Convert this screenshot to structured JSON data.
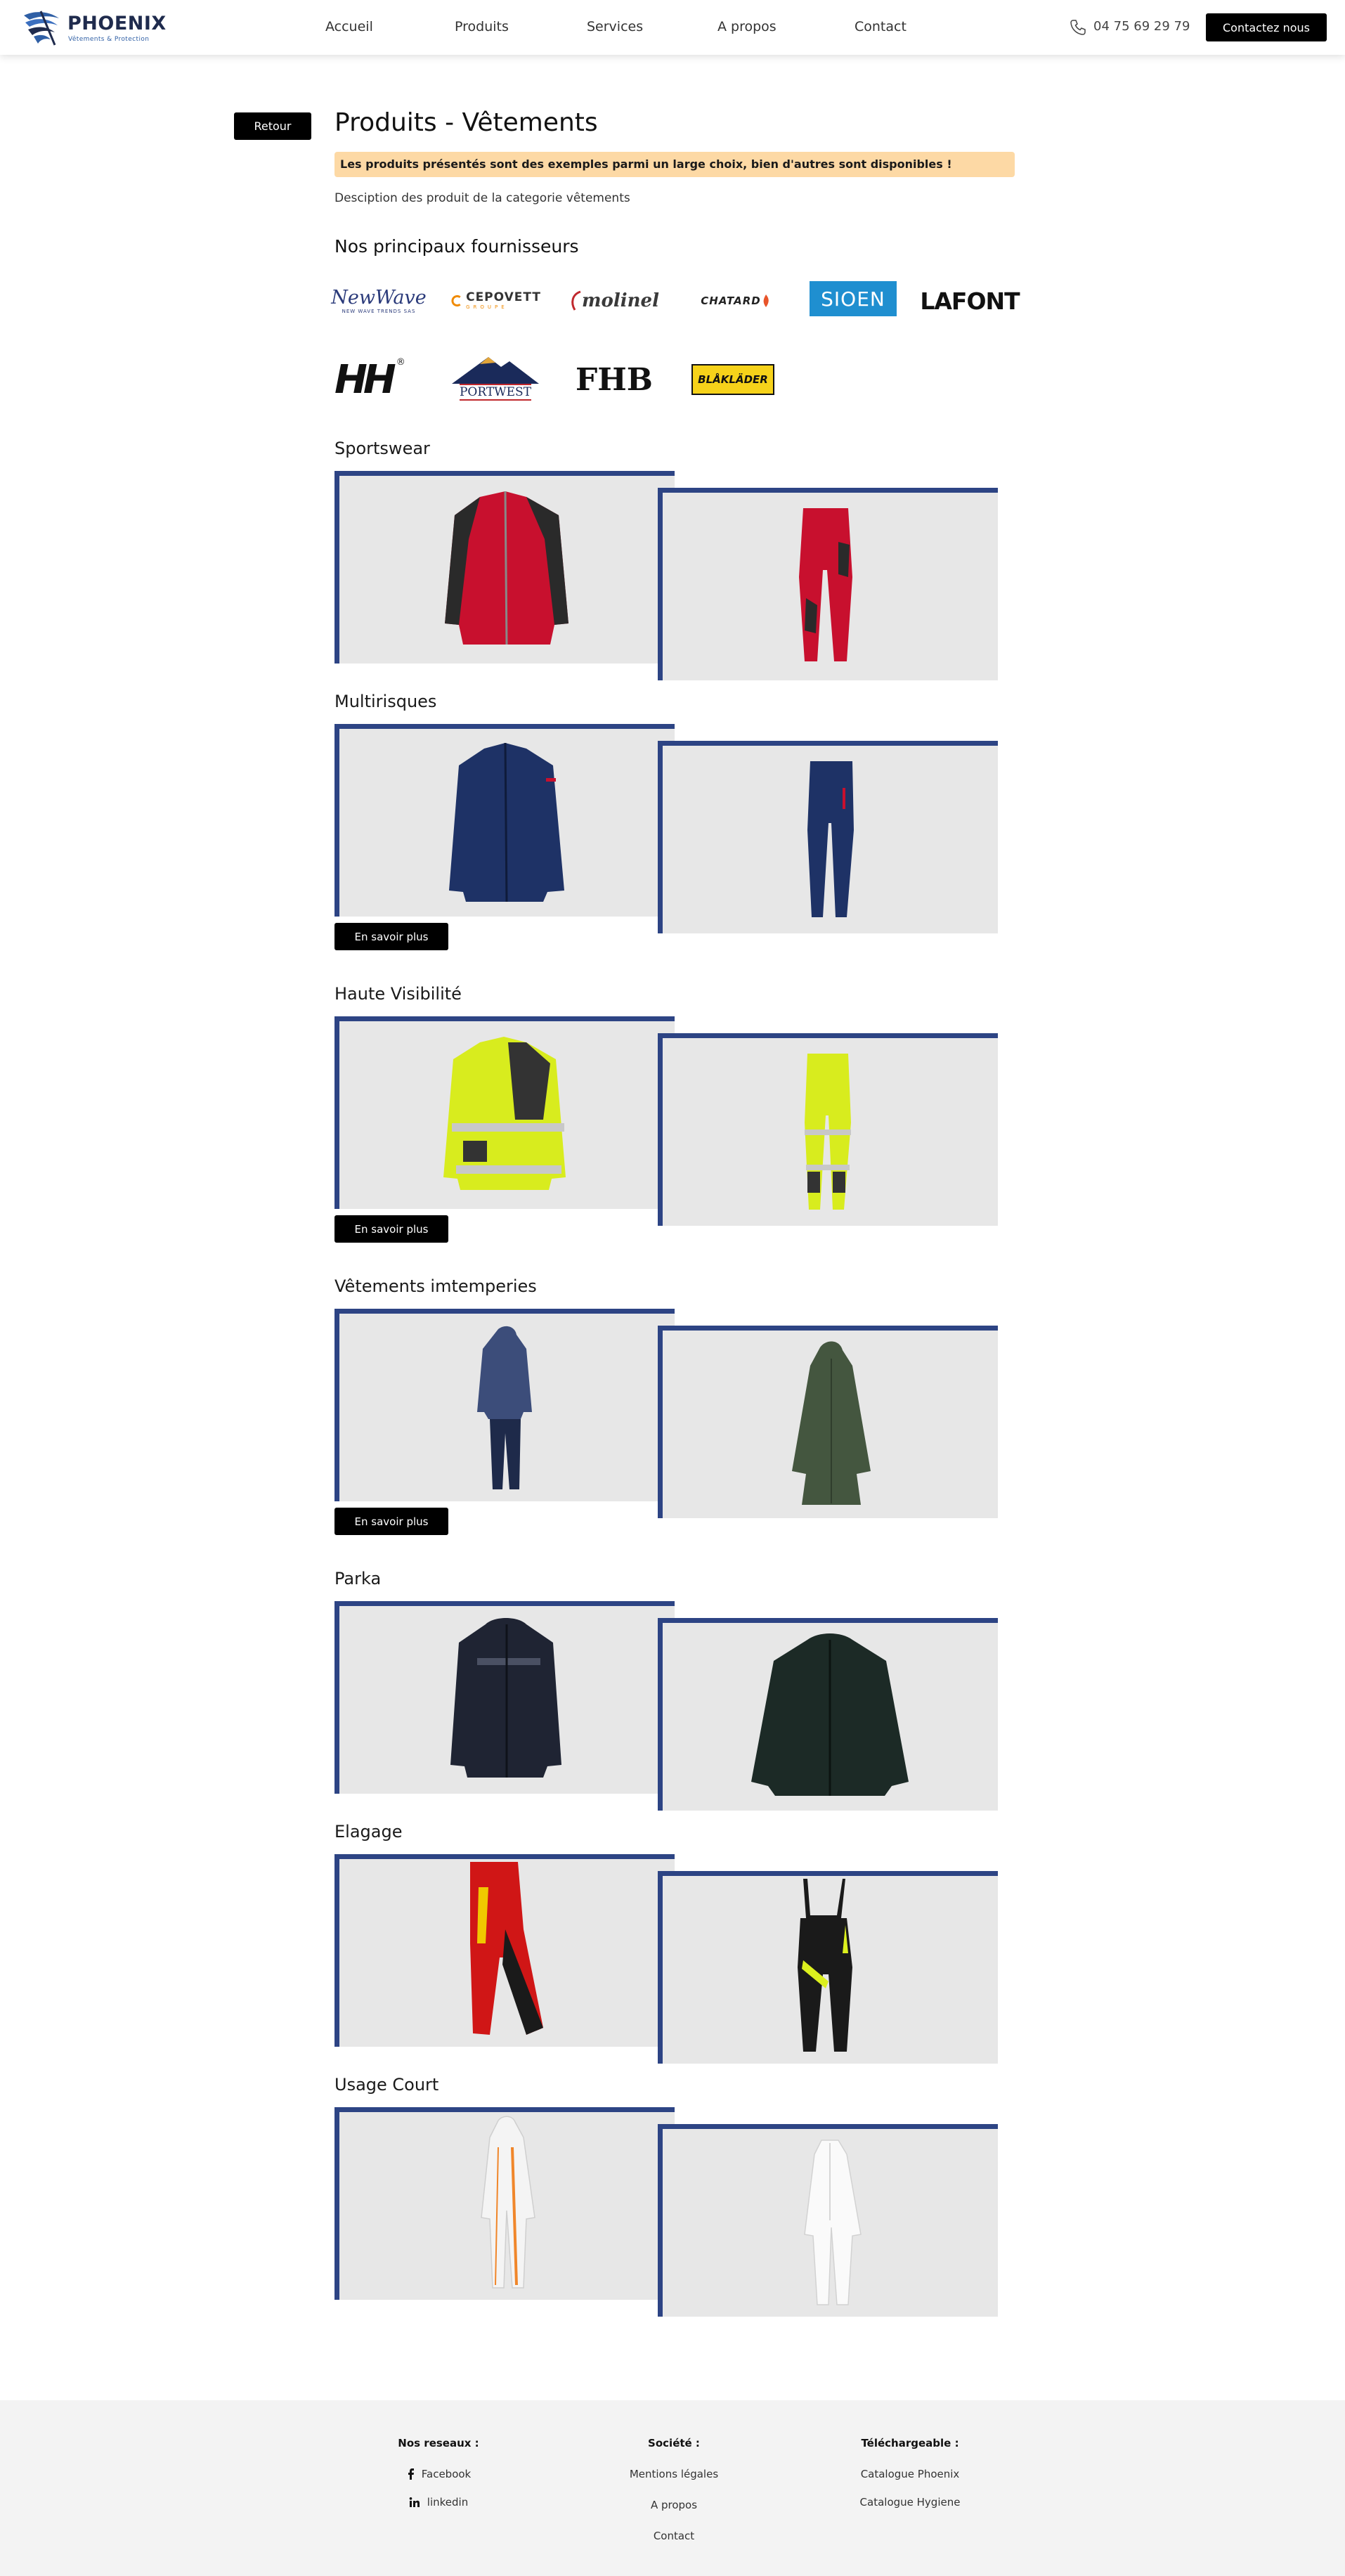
{
  "header": {
    "brand_name": "PHOENIX",
    "brand_tagline": "Vêtements & Protection",
    "nav": [
      "Accueil",
      "Produits",
      "Services",
      "A propos",
      "Contact"
    ],
    "phone": "04 75 69 29 79",
    "contact_button": "Contactez nous",
    "icons": {
      "logo": "phoenix-wing-logo",
      "phone": "phone-icon"
    }
  },
  "page": {
    "back_button": "Retour",
    "title": "Produits - Vêtements",
    "notice": "Les produits présentés sont des exemples parmi un large choix, bien d'autres sont disponibles !",
    "description": "Desciption des produit de la categorie vêtements",
    "suppliers_title": "Nos principaux fournisseurs"
  },
  "suppliers": [
    "NewWave",
    "CEPOVETT",
    "molinel",
    "CHATARD",
    "SIOEN",
    "LAFONT",
    "HH",
    "PORTWEST",
    "FHB",
    "BLÅKLÄDER"
  ],
  "supplier_sublabels": {
    "newwave": "NEW WAVE TRENDS SAS",
    "cepovett": "GROUPE"
  },
  "categories": [
    {
      "title": "Sportswear",
      "items": [
        "red-softshell-jacket",
        "red-work-trousers"
      ]
    },
    {
      "title": "Multirisques",
      "items": [
        "navy-multirisk-jacket",
        "navy-multirisk-trousers"
      ],
      "button": "En savoir plus"
    },
    {
      "title": "Haute Visibilité",
      "items": [
        "hi-vis-yellow-jacket",
        "hi-vis-yellow-trousers"
      ],
      "button": "En savoir plus"
    },
    {
      "title": "Vêtements imtemperies",
      "items": [
        "navy-rain-suit",
        "green-rain-coat"
      ],
      "button": "En savoir plus"
    },
    {
      "title": "Parka",
      "items": [
        "navy-parka",
        "dark-green-parka"
      ]
    },
    {
      "title": "Elagage",
      "items": [
        "red-chainsaw-trousers",
        "black-chainsaw-bib"
      ]
    },
    {
      "title": "Usage Court",
      "items": [
        "white-disposable-coverall-orange",
        "white-disposable-coverall"
      ]
    }
  ],
  "colors": {
    "card_border": "#2d4484",
    "card_bg": "#e7e7e7",
    "notice_bg": "#fdd9a5",
    "button_bg": "#000000",
    "footer_bg": "#f3f3f3"
  },
  "footer": {
    "networks": {
      "title": "Nos reseaux :",
      "links": [
        "Facebook",
        "linkedin"
      ]
    },
    "company": {
      "title": "Société :",
      "links": [
        "Mentions légales",
        "A propos",
        "Contact"
      ]
    },
    "downloads": {
      "title": "Téléchargeable :",
      "links": [
        "Catalogue Phoenix",
        "Catalogue Hygiene"
      ]
    }
  }
}
